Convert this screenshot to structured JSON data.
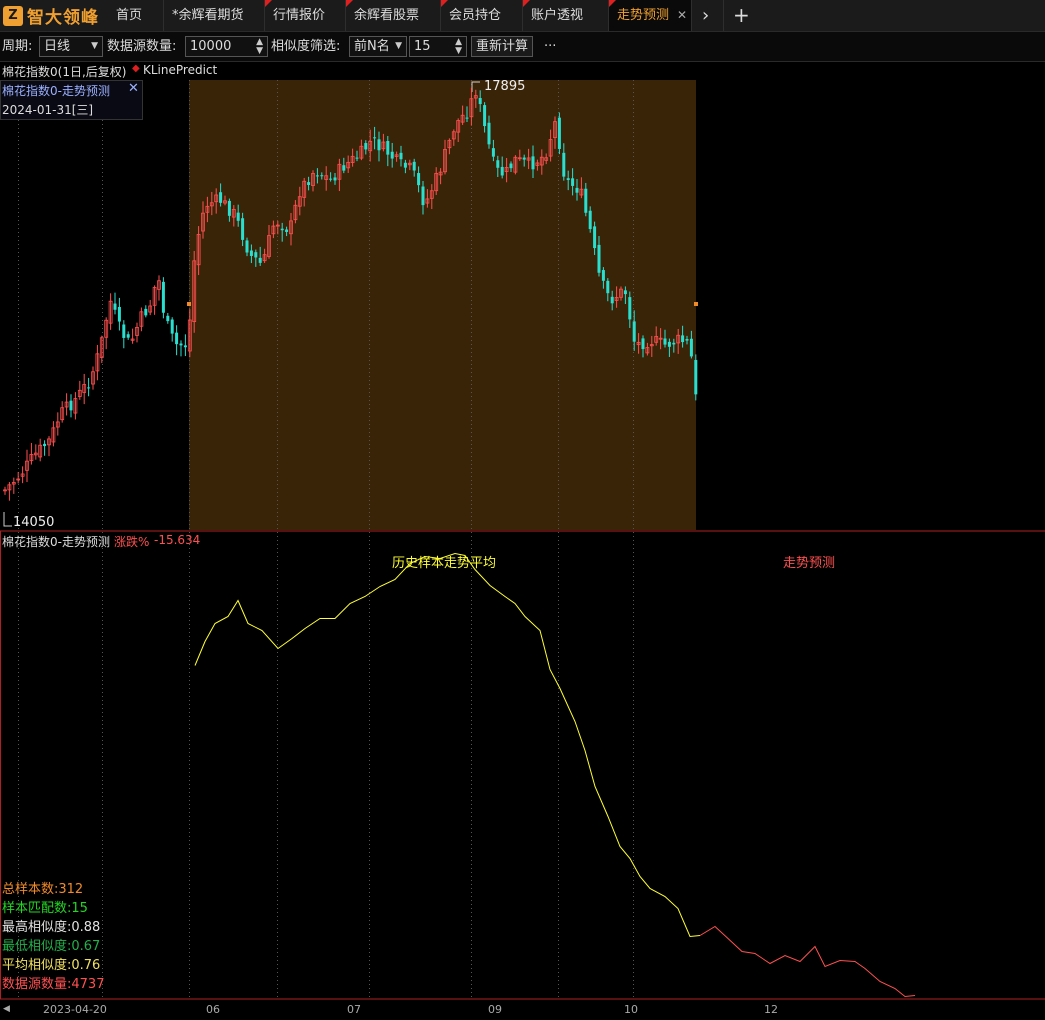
{
  "tabs": {
    "logo_text": "智大领峰",
    "items": [
      {
        "label": "首页",
        "flag": false
      },
      {
        "label": "*余辉看期货",
        "flag": false
      },
      {
        "label": "行情报价",
        "flag": true
      },
      {
        "label": "余辉看股票",
        "flag": true
      },
      {
        "label": "会员持仓",
        "flag": true
      },
      {
        "label": "账户透视",
        "flag": true
      },
      {
        "label": "走势预测",
        "flag": true,
        "active": true
      }
    ],
    "close_glyph": "✕",
    "more_glyph": "›",
    "add_glyph": "+"
  },
  "toolbar": {
    "period_label": "周期:",
    "period_value": "日线",
    "datasource_label": "数据源数量:",
    "datasource_value": "10000",
    "filter_label": "相似度筛选:",
    "filter_value": "前N名",
    "topn_value": "15",
    "recalc_label": "重新计算",
    "more_label": "···"
  },
  "main_chart": {
    "header_title": "棉花指数0(1日,后复权)",
    "indicator_name": "KLinePredict",
    "info_title": "棉花指数0-走势预测",
    "info_date": "2024-01-31[三]",
    "high_label": "17895",
    "low_label": "14050"
  },
  "sub_chart": {
    "header_title": "棉花指数0-走势预测",
    "change_label": "涨跌%",
    "change_value": "-15.634",
    "avg_label": "历史样本走势平均",
    "predict_label": "走势预测",
    "stats": [
      {
        "text": "总样本数:312",
        "color": "#f08a2a"
      },
      {
        "text": "样本匹配数:15",
        "color": "#22d622"
      },
      {
        "text": "最高相似度:0.88",
        "color": "#e0e0e0"
      },
      {
        "text": "最低相似度:0.67",
        "color": "#22b04a"
      },
      {
        "text": "平均相似度:0.76",
        "color": "#f0e060"
      },
      {
        "text": "数据源数量:4737",
        "color": "#ff5050"
      }
    ]
  },
  "xaxis": {
    "start_label": "2023-04-20",
    "ticks": [
      "06",
      "07",
      "09",
      "10",
      "12"
    ]
  },
  "colors": {
    "up": "#ff5050",
    "down": "#29e0d0",
    "highlight_bg": "#3a2408",
    "avg_line": "#ffff33",
    "predict_line": "#ff5050",
    "accent": "#f0a030",
    "border_red": "#b02020"
  }
}
